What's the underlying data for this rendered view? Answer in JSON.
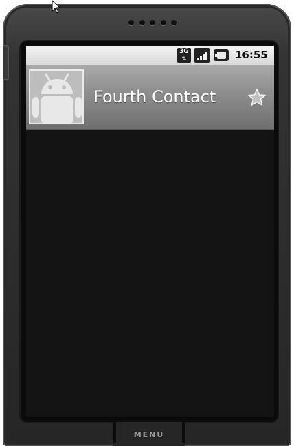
{
  "status_bar": {
    "network_type": "3G",
    "network_arrows": "⇅",
    "time": "16:55",
    "icons": [
      "3g-data-icon",
      "signal-strength-icon",
      "battery-icon"
    ]
  },
  "contact": {
    "name": "Fourth Contact",
    "photo_icon": "android-robot-placeholder",
    "starred": false,
    "star_icon": "star-outline-icon"
  },
  "hardware": {
    "menu_label": "MENU"
  },
  "colors": {
    "header_gradient_top": "#a9a9a9",
    "header_gradient_bottom": "#6f6f6f",
    "screen_background": "#141414",
    "phone_body": "#2c2c2c",
    "status_bar": "#e0e0e0"
  }
}
